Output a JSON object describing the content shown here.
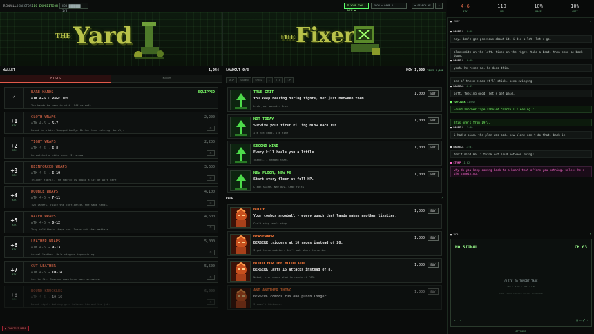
{
  "topbar": {
    "items": [
      "REDWALL",
      "DIRECTORY",
      "SEC EXPEDITION"
    ],
    "tape_label": "HDD",
    "tape_value": "███████ 1/8",
    "btn_green": "☰ YOUR GYM GAME ◆",
    "btn_dark": "SHOP ▾ GAME 1",
    "right_tag": "◆ SEARCH ME",
    "right_icon": "⌕"
  },
  "hero": {
    "left_the": "THE",
    "left_title": "Yard",
    "right_the": "THE",
    "right_title": "Fixer"
  },
  "wallet": {
    "label": "WALLET",
    "value": "1,044"
  },
  "tabs": {
    "fists": "FISTS",
    "body": "BODY"
  },
  "fists": [
    {
      "lvl": "",
      "sub": "",
      "name": "BARE HANDS",
      "stat": "ATK 4-6 · RAGE 10%",
      "arrow": "",
      "to": "",
      "desc": "The hands he came in with. Office soft.",
      "price": "EQUIPPED"
    },
    {
      "lvl": "+1",
      "sub": "ATK",
      "name": "CLOTH WRAPS",
      "stat": "ATK 4-6 ",
      "arrow": "→",
      "to": " 5-7",
      "desc": "Found in a bin. Wrapped badly. Better than nothing, barely.",
      "price": "2,200"
    },
    {
      "lvl": "+2",
      "sub": "ATK",
      "name": "TIGHT WRAPS",
      "stat": "ATK 4-6 ",
      "arrow": "→",
      "to": " 6-8",
      "desc": "He watched a video once. It shows.",
      "price": "2,200"
    },
    {
      "lvl": "+3",
      "sub": "ATK",
      "name": "REINFORCED WRAPS",
      "stat": "ATK 4-6 ",
      "arrow": "→",
      "to": " 6-10",
      "desc": "Thicker fabric. The fabric is doing a lot of work here.",
      "price": "3,600"
    },
    {
      "lvl": "+4",
      "sub": "ATK",
      "name": "DOUBLE WRAPS",
      "stat": "ATK 4-6 ",
      "arrow": "→",
      "to": " 7-11",
      "desc": "Two layers. Twice the confidence, the same hands.",
      "price": "4,100"
    },
    {
      "lvl": "+5",
      "sub": "ATK",
      "name": "WAXED WRAPS",
      "stat": "ATK 4-6 ",
      "arrow": "→",
      "to": " 8-12",
      "desc": "They hold their shape now. Turns out that matters.",
      "price": "4,600"
    },
    {
      "lvl": "+6",
      "sub": "ATK",
      "name": "LEATHER WRAPS",
      "stat": "ATK 4-6 ",
      "arrow": "→",
      "to": " 9-13",
      "desc": "Actual leather. He's stopped improvising.",
      "price": "5,000"
    },
    {
      "lvl": "+7",
      "sub": "ATK",
      "name": "CUT LEATHER",
      "stat": "ATK 4-6 ",
      "arrow": "→",
      "to": " 10-14",
      "desc": "Cut to fit. Someone down here owns scissors.",
      "price": "5,500"
    },
    {
      "lvl": "+8",
      "sub": "ATK",
      "name": "BOUND KNUCKLES",
      "stat": "ATK 4-6 ",
      "arrow": "→",
      "to": " 10-16",
      "desc": "Bound tight. Nothing gets between him and the job.",
      "price": "6,000"
    }
  ],
  "loadout": {
    "label": "LOADOUT 0/3",
    "now_label": "NOW",
    "now_value": "1,000",
    "now_sub": "TOKEN 2,042",
    "buttons": [
      "GRIP",
      "STANCE",
      "SPEED",
      "⟂",
      "T.A",
      "T.P"
    ]
  },
  "perks": [
    {
      "name": "TRUE GRIT",
      "color": "#7dff6a",
      "desc": "You keep healing during fights, not just between them.",
      "flavor": "Lick your wounds. Once.",
      "price": "1,000",
      "buy": "BUY",
      "hue": "green"
    },
    {
      "name": "NOT TODAY",
      "color": "#7dff6a",
      "desc": "Survive your first killing blow each run.",
      "flavor": "I'm not dead. I'm fine.",
      "price": "1,000",
      "buy": "BUY",
      "hue": "green"
    },
    {
      "name": "SECOND WIND",
      "color": "#7dff6a",
      "desc": "Every kill heals you a little.",
      "flavor": "Thanks. I needed that.",
      "price": "1,000",
      "buy": "BUY",
      "hue": "green"
    },
    {
      "name": "NEW FLOOR, NEW ME",
      "color": "#7dff6a",
      "desc": "Start every floor at full HP.",
      "flavor": "Clean slate. New guy. Same fists.",
      "price": "1,000",
      "buy": "BUY",
      "hue": "green"
    }
  ],
  "rage_label": "RAGE",
  "rage_perks": [
    {
      "name": "BULLY",
      "color": "#ff7a3a",
      "desc": "Your combos snowball - every punch that lands makes another likelier.",
      "flavor": "Can't stop won't stop.",
      "price": "1,000",
      "buy": "BUY",
      "hue": "red"
    },
    {
      "name": "BERSERKER",
      "color": "#ff7a3a",
      "desc": "BERSERK triggers at 10 rages instead of 20.",
      "flavor": "I get there quicker. Don't ask where there is.",
      "price": "1,000",
      "buy": "BUY",
      "hue": "red"
    },
    {
      "name": "BLOOD FOR THE BLOOD GOD",
      "color": "#ff7a3a",
      "desc": "BERSERK lasts 15 attacks instead of 8.",
      "flavor": "Nobody ever asked what he needs it FOR.",
      "price": "1,000",
      "buy": "BUY",
      "hue": "red"
    },
    {
      "name": "AND ANOTHER THING",
      "color": "#ff7a3a",
      "desc": "BERSERK combos run one punch longer.",
      "flavor": "I wasn't finished.",
      "price": "1,000",
      "buy": "BUY",
      "hue": "red"
    }
  ],
  "stats": [
    {
      "v": "4-6",
      "l": "ATK",
      "c": "#e06a4a"
    },
    {
      "v": "110",
      "l": "HP",
      "c": "#dcdcdc"
    },
    {
      "v": "10%",
      "l": "RAGE",
      "c": "#dcdcdc"
    },
    {
      "v": "10%",
      "l": "CRIT",
      "c": "#dcdcdc"
    }
  ],
  "chat": {
    "header": "CHAT",
    "messages": [
      {
        "who": "DARRELL",
        "t": "10:58",
        "text": "hey. don't get precious about it, i die a lot. let's go.",
        "style": "norm"
      },
      {
        "who": "",
        "t": "",
        "text": "blacksmith on the left. fixer on the right. take a beat, then send me back down.",
        "style": "norm"
      },
      {
        "who": "DARRELL",
        "t": "10:59",
        "text": "yeah. he reset me. he does this.",
        "style": "norm"
      },
      {
        "who": "",
        "t": "",
        "text": "one of these times it'll stick. keep swinging.",
        "style": "norm"
      },
      {
        "who": "DARRELL",
        "t": "10:59",
        "text": "left. feeling good. let's get paid.",
        "style": "norm"
      },
      {
        "who": "YOU-JINX",
        "t": "11:00",
        "text": "Found another tape labeled \"Darrell sleeping.\"",
        "style": "green"
      },
      {
        "who": "",
        "t": "",
        "text": "This one's from 1973.",
        "style": "green"
      },
      {
        "who": "DARRELL",
        "t": "11:00",
        "text": "i had a plan. the plan was bad. new plan: don't do that. back in.",
        "style": "norm"
      },
      {
        "who": "DARRELL",
        "t": "11:01",
        "text": "don't mind me. i think out loud between swings.",
        "style": "norm"
      },
      {
        "who": "STUMP",
        "t": "11:02",
        "text": "why do you keep coming back to a board that offers you nothing. unless he's the something.",
        "style": "pink"
      }
    ]
  },
  "tv": {
    "header": "VCR",
    "title": "NO SIGNAL",
    "channel": "CH 03",
    "cta": "CLICK TO INSERT TAPE",
    "sub": "REC · STOP · REV · FWD",
    "hint": "some tapes contain an old broadcast",
    "footer": "OPTIONS",
    "playtest": "▲ PLAYTEST MODE"
  }
}
